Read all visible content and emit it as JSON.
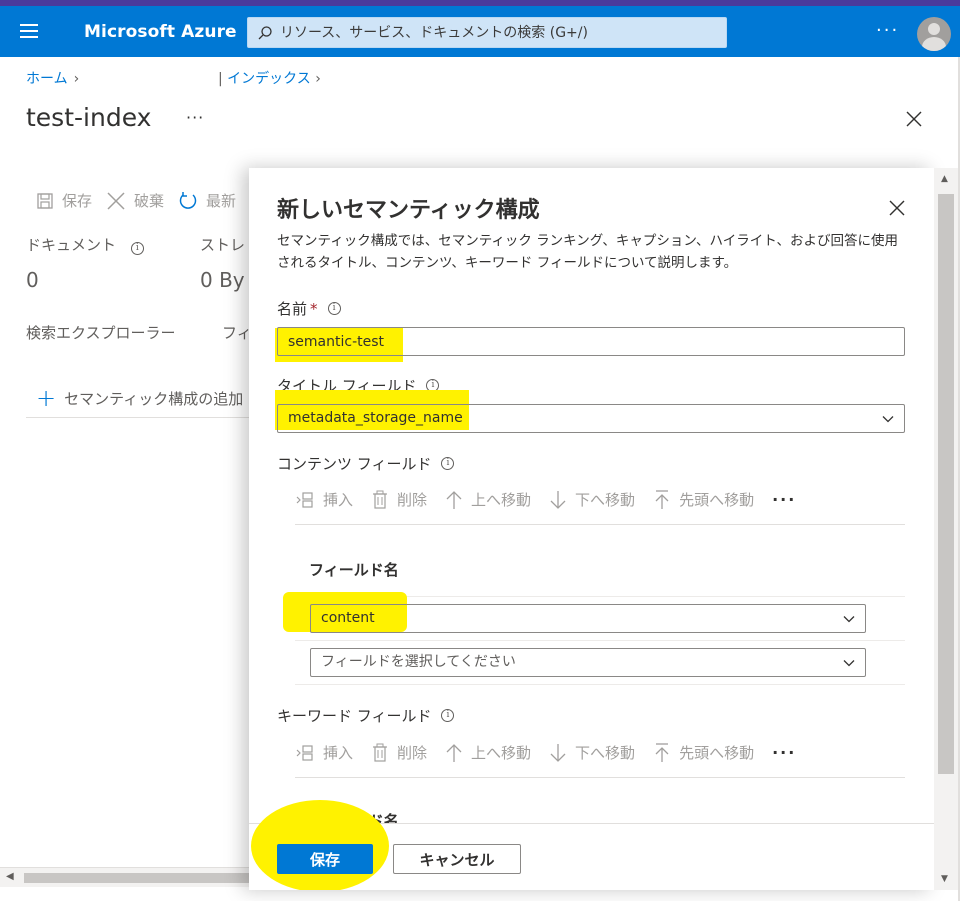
{
  "header": {
    "brand": "Microsoft Azure",
    "search_placeholder": "リソース、サービス、ドキュメントの検索 (G+/)",
    "accent_color": "#0078d4"
  },
  "breadcrumb": {
    "home": "ホーム",
    "indexes": "インデックス"
  },
  "page": {
    "title": "test-index"
  },
  "background": {
    "toolbar": {
      "save": "保存",
      "discard": "破棄",
      "refresh": "最新"
    },
    "stats": [
      {
        "label": "ドキュメント",
        "value": "0"
      },
      {
        "label": "ストレ",
        "value": "0 By"
      }
    ],
    "tabs": {
      "explorer": "検索エクスプローラー",
      "fields": "フィ"
    },
    "add_semantic": "セマンティック構成の追加"
  },
  "panel": {
    "title": "新しいセマンティック構成",
    "description": "セマンティック構成では、セマンティック ランキング、キャプション、ハイライト、および回答に使用されるタイトル、コンテンツ、キーワード フィールドについて説明します。",
    "name": {
      "label": "名前",
      "required_mark": "*",
      "value": "semantic-test"
    },
    "title_field": {
      "label": "タイトル フィールド",
      "value": "metadata_storage_name"
    },
    "content_fields": {
      "label": "コンテンツ フィールド",
      "commands": {
        "insert": "挿入",
        "delete": "削除",
        "move_up": "上へ移動",
        "move_down": "下へ移動",
        "move_top": "先頭へ移動",
        "more": "···"
      },
      "column_header": "フィールド名",
      "rows": [
        {
          "value": "content"
        },
        {
          "placeholder": "フィールドを選択してください"
        }
      ]
    },
    "keyword_fields": {
      "label": "キーワード フィールド",
      "commands": {
        "insert": "挿入",
        "delete": "削除",
        "move_up": "上へ移動",
        "move_down": "下へ移動",
        "move_top": "先頭へ移動",
        "more": "···"
      },
      "column_header": "フィールド名"
    },
    "footer": {
      "save": "保存",
      "cancel": "キャンセル"
    }
  },
  "annotation_color": "#fff200"
}
